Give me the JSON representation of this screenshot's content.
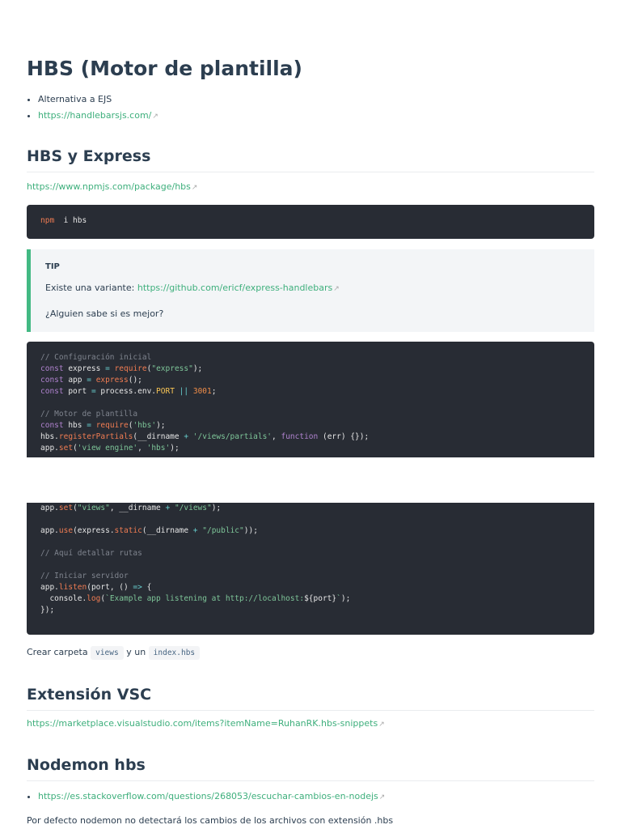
{
  "title": "HBS (Motor de plantilla)",
  "intro_items": [
    {
      "text": "Alternativa a EJS"
    },
    {
      "text": "https://handlebarsjs.com/"
    }
  ],
  "s1": {
    "heading": "HBS y Express",
    "link": "https://www.npmjs.com/package/hbs"
  },
  "npm_code": [
    [
      [
        "f",
        "npm"
      ],
      [
        "",
        "  i hbs"
      ]
    ]
  ],
  "tip": {
    "title": "TIP",
    "line1_prefix": "Existe una variante: ",
    "line1_link": "https://github.com/ericf/express-handlebars",
    "line2": "¿Alguien sabe si es mejor?"
  },
  "code1": [
    [
      [
        "c",
        "// Configuración inicial"
      ]
    ],
    [
      [
        "k",
        "const"
      ],
      [
        "",
        " express "
      ],
      [
        "o",
        "="
      ],
      [
        "",
        " "
      ],
      [
        "f",
        "require"
      ],
      [
        "",
        "("
      ],
      [
        "s",
        "\"express\""
      ],
      [
        "",
        ");"
      ]
    ],
    [
      [
        "k",
        "const"
      ],
      [
        "",
        " app "
      ],
      [
        "o",
        "="
      ],
      [
        "",
        " "
      ],
      [
        "f",
        "express"
      ],
      [
        "",
        "();"
      ]
    ],
    [
      [
        "k",
        "const"
      ],
      [
        "",
        " port "
      ],
      [
        "o",
        "="
      ],
      [
        "",
        " process.env."
      ],
      [
        "y",
        "PORT"
      ],
      [
        "",
        " "
      ],
      [
        "o",
        "||"
      ],
      [
        "",
        " "
      ],
      [
        "n",
        "3001"
      ],
      [
        "",
        ";"
      ]
    ],
    [
      [
        "",
        ""
      ]
    ],
    [
      [
        "c",
        "// Motor de plantilla"
      ]
    ],
    [
      [
        "k",
        "const"
      ],
      [
        "",
        " hbs "
      ],
      [
        "o",
        "="
      ],
      [
        "",
        " "
      ],
      [
        "f",
        "require"
      ],
      [
        "",
        "("
      ],
      [
        "s",
        "'hbs'"
      ],
      [
        "",
        ");"
      ]
    ],
    [
      [
        "",
        "hbs."
      ],
      [
        "f",
        "registerPartials"
      ],
      [
        "",
        "(__dirname "
      ],
      [
        "o",
        "+"
      ],
      [
        "",
        " "
      ],
      [
        "s",
        "'/views/partials'"
      ],
      [
        "",
        ", "
      ],
      [
        "k",
        "function"
      ],
      [
        "",
        " (err) {});"
      ]
    ],
    [
      [
        "",
        "app."
      ],
      [
        "f",
        "set"
      ],
      [
        "",
        "("
      ],
      [
        "s",
        "'view engine'"
      ],
      [
        "",
        ", "
      ],
      [
        "s",
        "'hbs'"
      ],
      [
        "",
        ");"
      ]
    ]
  ],
  "code2": [
    [
      [
        "",
        "app."
      ],
      [
        "f",
        "set"
      ],
      [
        "",
        "("
      ],
      [
        "s",
        "\"views\""
      ],
      [
        "",
        ", __dirname "
      ],
      [
        "o",
        "+"
      ],
      [
        "",
        " "
      ],
      [
        "s",
        "\"/views\""
      ],
      [
        "",
        ");"
      ]
    ],
    [
      [
        "",
        ""
      ]
    ],
    [
      [
        "",
        "app."
      ],
      [
        "f",
        "use"
      ],
      [
        "",
        "(express."
      ],
      [
        "f",
        "static"
      ],
      [
        "",
        "(__dirname "
      ],
      [
        "o",
        "+"
      ],
      [
        "",
        " "
      ],
      [
        "s",
        "\"/public\""
      ],
      [
        "",
        "));"
      ]
    ],
    [
      [
        "",
        ""
      ]
    ],
    [
      [
        "c",
        "// Aquí detallar rutas"
      ]
    ],
    [
      [
        "",
        ""
      ]
    ],
    [
      [
        "c",
        "// Iniciar servidor"
      ]
    ],
    [
      [
        "",
        "app."
      ],
      [
        "f",
        "listen"
      ],
      [
        "",
        "(port, () "
      ],
      [
        "o",
        "=>"
      ],
      [
        "",
        " {"
      ]
    ],
    [
      [
        "",
        "  console."
      ],
      [
        "f",
        "log"
      ],
      [
        "",
        "("
      ],
      [
        "s",
        "`Example app listening at http://localhost:"
      ],
      [
        "",
        "${port}"
      ],
      [
        "s",
        "`"
      ],
      [
        "",
        ");"
      ]
    ],
    [
      [
        "",
        "});"
      ]
    ]
  ],
  "crear": {
    "prefix": "Crear carpeta ",
    "code1": "views",
    "mid": " y un ",
    "code2": "index.hbs"
  },
  "s2": {
    "heading": "Extensión VSC",
    "link": "https://marketplace.visualstudio.com/items?itemName=RuhanRK.hbs-snippets"
  },
  "s3": {
    "heading": "Nodemon hbs",
    "link": "https://es.stackoverflow.com/questions/268053/escuchar-cambios-en-nodejs",
    "text": "Por defecto nodemon no detectará los cambios de los archivos con extensión .hbs"
  }
}
